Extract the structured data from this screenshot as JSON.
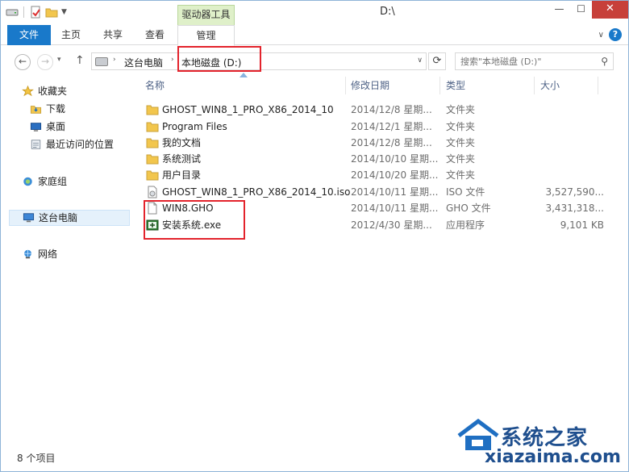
{
  "window": {
    "title": "D:\\",
    "context_tab_group": "驱动器工具"
  },
  "ribbon": {
    "tabs": [
      {
        "label": "文件"
      },
      {
        "label": "主页"
      },
      {
        "label": "共享"
      },
      {
        "label": "查看"
      },
      {
        "label": "管理"
      }
    ]
  },
  "address": {
    "crumbs": [
      "这台电脑",
      "本地磁盘 (D:)"
    ],
    "search_placeholder": "搜索\"本地磁盘 (D:)\""
  },
  "sidebar": {
    "items": [
      {
        "label": "收藏夹",
        "icon": "star-icon"
      },
      {
        "label": "下载",
        "icon": "download-folder-icon"
      },
      {
        "label": "桌面",
        "icon": "desktop-icon"
      },
      {
        "label": "最近访问的位置",
        "icon": "recent-places-icon"
      },
      {
        "label": "家庭组",
        "icon": "homegroup-icon"
      },
      {
        "label": "这台电脑",
        "icon": "computer-icon"
      },
      {
        "label": "网络",
        "icon": "network-icon"
      }
    ]
  },
  "columns": {
    "name": "名称",
    "date": "修改日期",
    "type": "类型",
    "size": "大小"
  },
  "files": [
    {
      "name": "GHOST_WIN8_1_PRO_X86_2014_10",
      "date": "2014/12/8 星期...",
      "type": "文件夹",
      "size": "",
      "icon": "folder-icon"
    },
    {
      "name": "Program Files",
      "date": "2014/12/1 星期...",
      "type": "文件夹",
      "size": "",
      "icon": "folder-icon"
    },
    {
      "name": "我的文档",
      "date": "2014/12/8 星期...",
      "type": "文件夹",
      "size": "",
      "icon": "folder-icon"
    },
    {
      "name": "系统测试",
      "date": "2014/10/10 星期...",
      "type": "文件夹",
      "size": "",
      "icon": "folder-icon"
    },
    {
      "name": "用户目录",
      "date": "2014/10/20 星期...",
      "type": "文件夹",
      "size": "",
      "icon": "folder-icon"
    },
    {
      "name": "GHOST_WIN8_1_PRO_X86_2014_10.iso",
      "date": "2014/10/11 星期...",
      "type": "ISO 文件",
      "size": "3,527,590...",
      "icon": "iso-file-icon"
    },
    {
      "name": "WIN8.GHO",
      "date": "2014/10/11 星期...",
      "type": "GHO 文件",
      "size": "3,431,318...",
      "icon": "blank-file-icon"
    },
    {
      "name": "安装系统.exe",
      "date": "2012/4/30 星期...",
      "type": "应用程序",
      "size": "9,101 KB",
      "icon": "installer-exe-icon"
    }
  ],
  "status": {
    "count": "8 个项目"
  },
  "watermark": {
    "brand": "系统之家",
    "url": "xiazaima.com"
  },
  "colors": {
    "file_tab": "#1979ca",
    "context_tab": "#dff0c9",
    "highlight": "#e3232c",
    "folder": "#f2c64d"
  }
}
